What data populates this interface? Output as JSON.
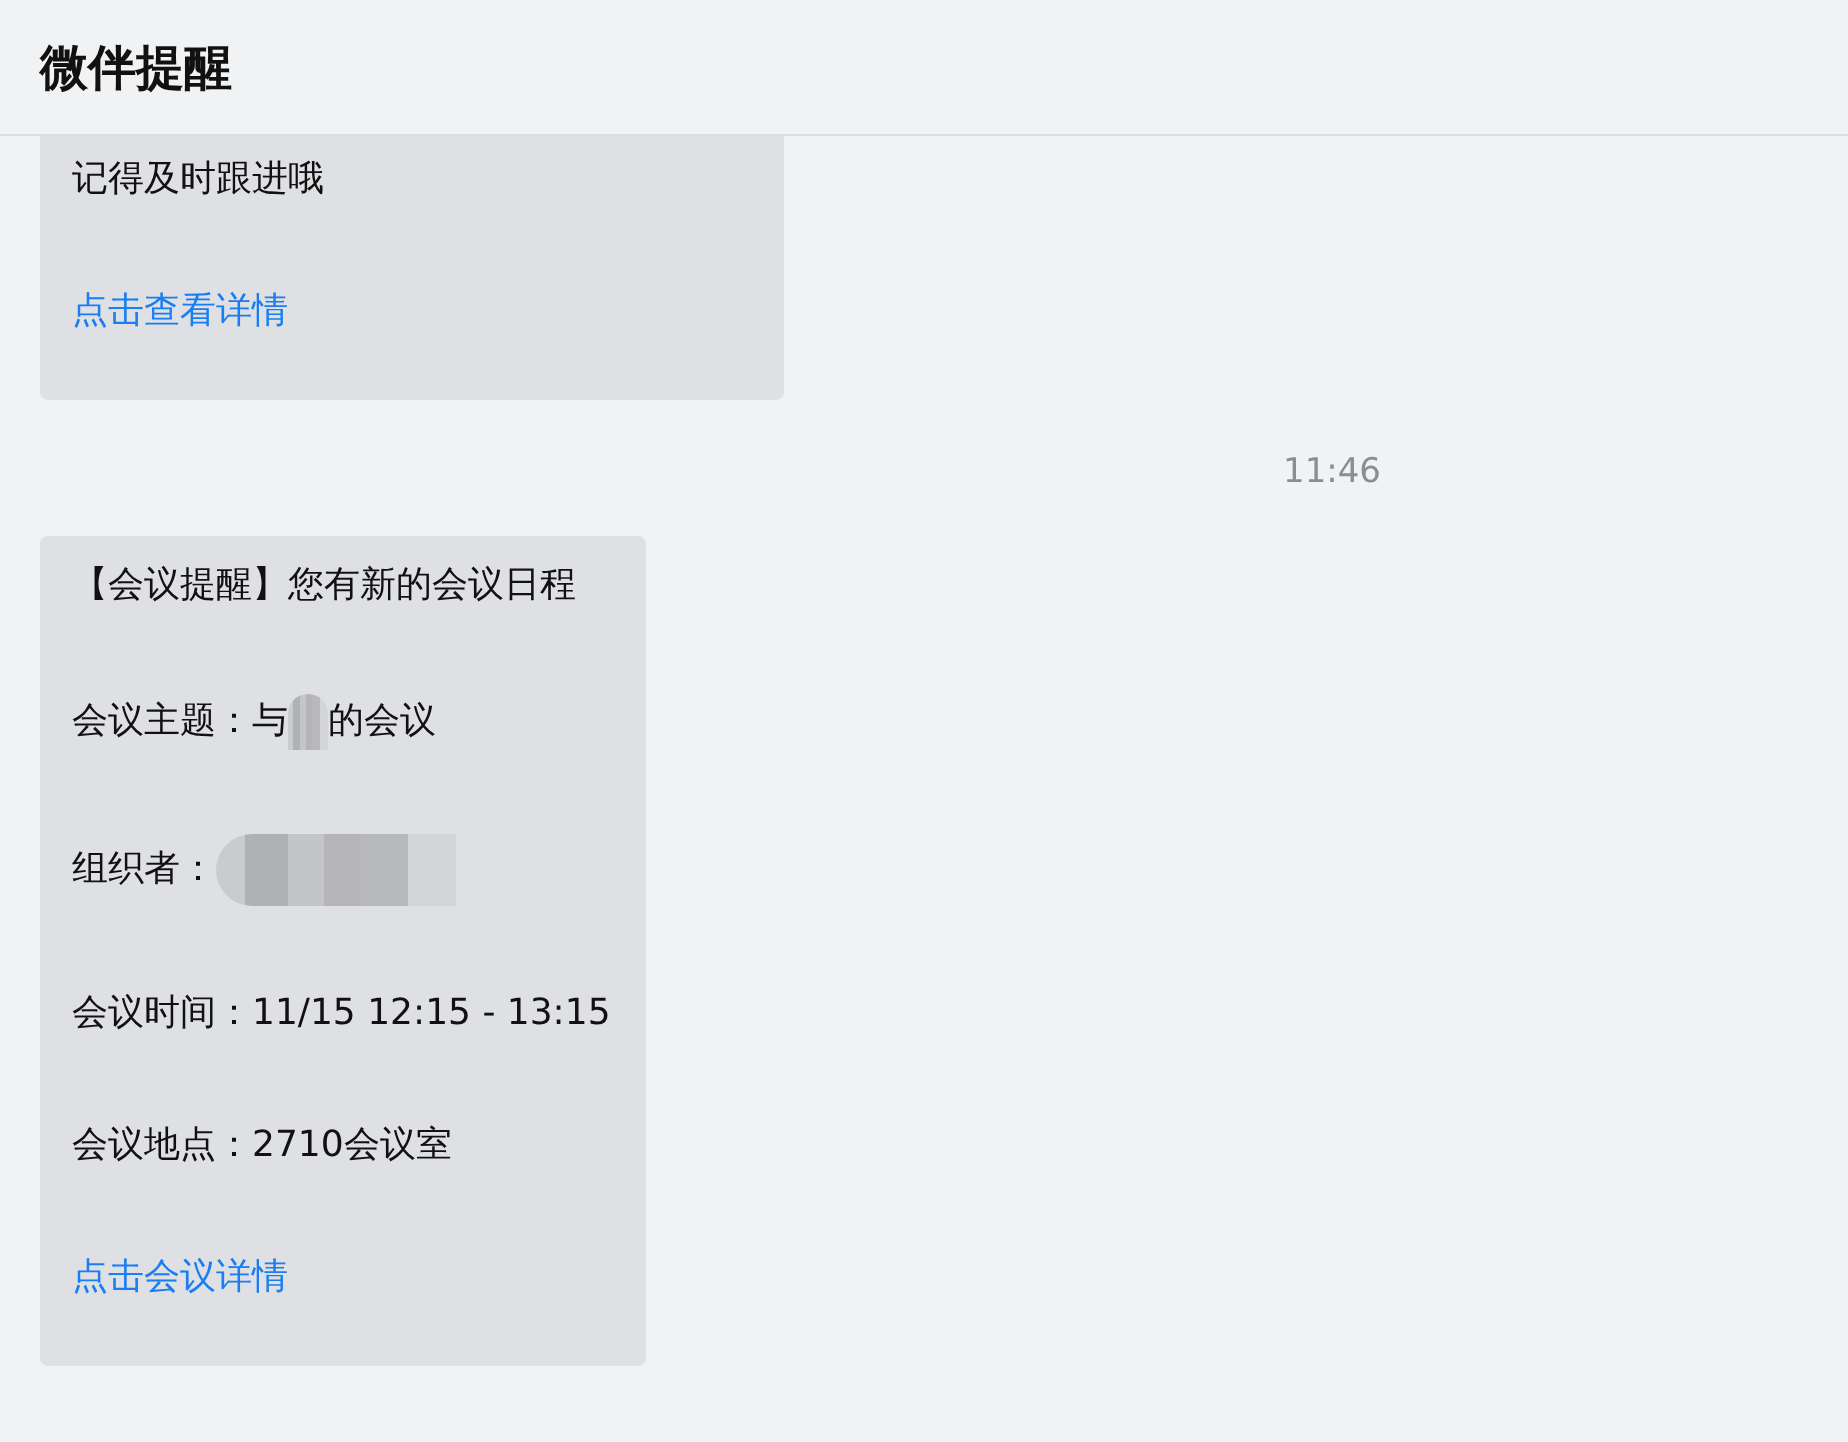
{
  "header": {
    "title": "微伴提醒"
  },
  "messages": [
    {
      "kind": "card",
      "lines": [
        {
          "kind": "text",
          "segments": [
            {
              "kind": "text",
              "text": "记得及时跟进哦"
            }
          ]
        },
        {
          "kind": "link",
          "segments": [
            {
              "kind": "text",
              "text": "点击查看详情"
            }
          ]
        }
      ]
    },
    {
      "kind": "time",
      "text": "11:46"
    },
    {
      "kind": "card",
      "lines": [
        {
          "kind": "text",
          "segments": [
            {
              "kind": "text",
              "text": "【会议提醒】您有新的会议日程"
            }
          ]
        },
        {
          "kind": "text",
          "segments": [
            {
              "kind": "text",
              "text": "会议主题：与"
            },
            {
              "kind": "redacted"
            },
            {
              "kind": "text",
              "text": "的会议"
            }
          ]
        },
        {
          "kind": "text",
          "segments": [
            {
              "kind": "text",
              "text": "组织者："
            },
            {
              "kind": "redacted_wide"
            }
          ]
        },
        {
          "kind": "text",
          "segments": [
            {
              "kind": "text",
              "text": "会议时间：11/15 12:15 - 13:15"
            }
          ]
        },
        {
          "kind": "text",
          "segments": [
            {
              "kind": "text",
              "text": "会议地点：2710会议室"
            }
          ]
        },
        {
          "kind": "link",
          "segments": [
            {
              "kind": "text",
              "text": "点击会议详情"
            }
          ]
        }
      ]
    }
  ]
}
